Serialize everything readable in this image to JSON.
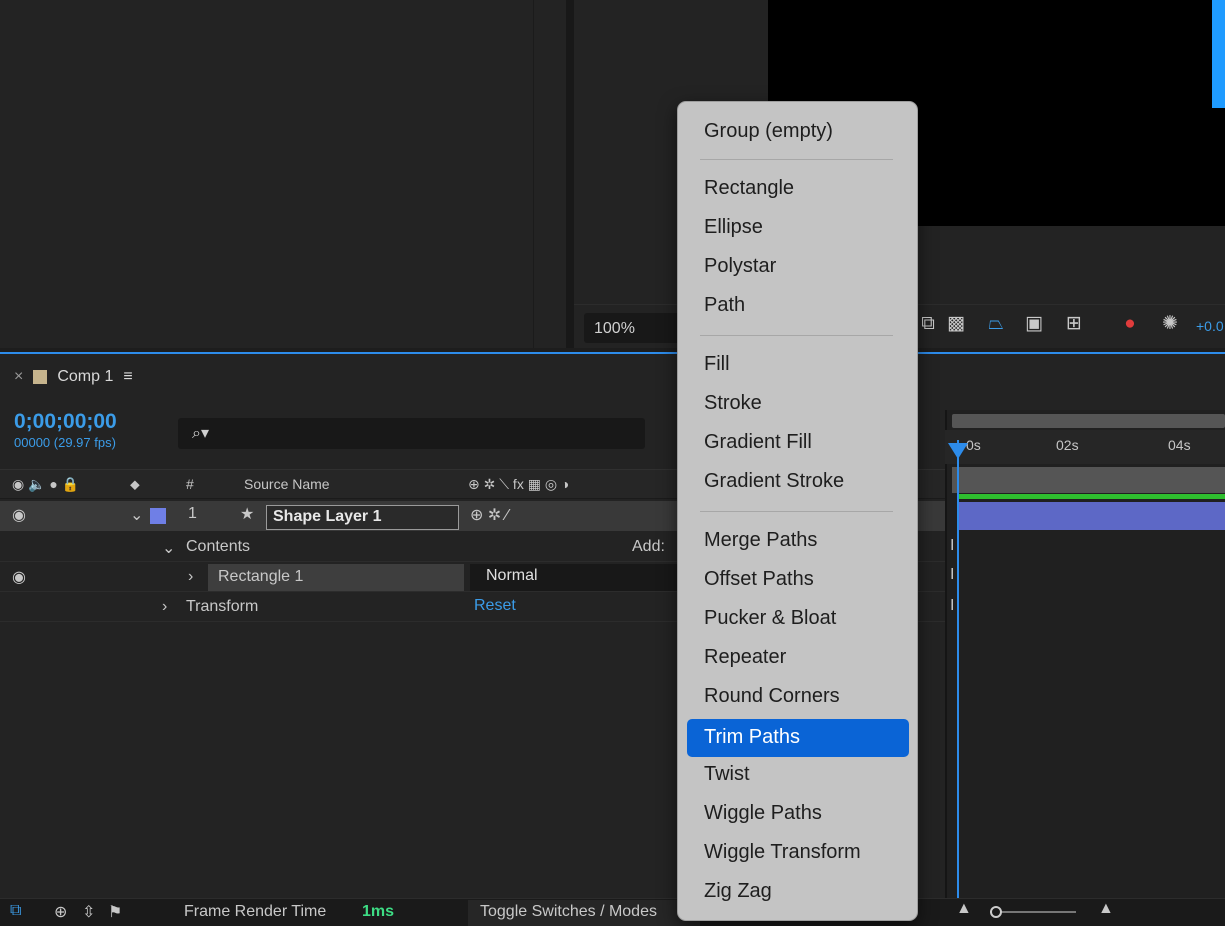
{
  "viewer": {
    "zoom_value": "100%",
    "exposure_readout": "+0.0",
    "toolbar_icons": [
      "snapshot-icon",
      "transparency-grid-icon",
      "mask-path-icon",
      "title-safe-icon",
      "region-icon",
      "channel-icon",
      "exposure-icon"
    ]
  },
  "timeline": {
    "comp_tab_close": "×",
    "comp_tab_label": "Comp 1",
    "comp_tab_menu": "≡",
    "timecode": "0;00;00;00",
    "frame_info": "00000 (29.97 fps)",
    "search_glyph": "⌕▾",
    "header": {
      "num": "#",
      "source_name": "Source Name",
      "switch_icons": "⊕ ✲ ⟍ fx ▦ ◎ ◑"
    },
    "layer": {
      "index": "1",
      "name": "Shape Layer 1",
      "color": "#6f7fe6"
    },
    "contents_label": "Contents",
    "add_label": "Add:",
    "rectangle_label": "Rectangle 1",
    "blend_mode": "Normal",
    "transform_label": "Transform",
    "reset_label": "Reset",
    "ruler": [
      "0s",
      "02s",
      "04s"
    ],
    "render_time_label": "Frame Render Time",
    "render_time_value": "1ms",
    "toggle_label": "Toggle Switches / Modes"
  },
  "context_menu": {
    "items": [
      {
        "label": "Group (empty)"
      },
      {
        "label": "Rectangle"
      },
      {
        "label": "Ellipse"
      },
      {
        "label": "Polystar"
      },
      {
        "label": "Path"
      },
      {
        "label": "Fill"
      },
      {
        "label": "Stroke"
      },
      {
        "label": "Gradient Fill"
      },
      {
        "label": "Gradient Stroke"
      },
      {
        "label": "Merge Paths"
      },
      {
        "label": "Offset Paths"
      },
      {
        "label": "Pucker & Bloat"
      },
      {
        "label": "Repeater"
      },
      {
        "label": "Round Corners"
      },
      {
        "label": "Trim Paths",
        "selected": true
      },
      {
        "label": "Twist"
      },
      {
        "label": "Wiggle Paths"
      },
      {
        "label": "Wiggle Transform"
      },
      {
        "label": "Zig Zag"
      }
    ]
  },
  "colors": {
    "accent": "#2d8ceb",
    "selected_menu": "#0a64d6",
    "render_ok": "#3ddc84"
  }
}
